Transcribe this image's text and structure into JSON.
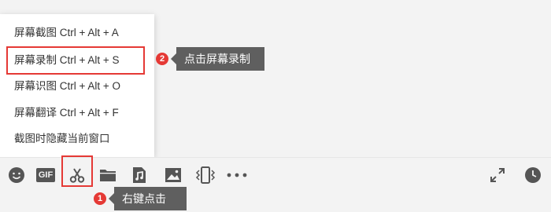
{
  "context_menu": {
    "items": [
      {
        "label": "屏幕截图 Ctrl + Alt + A"
      },
      {
        "label": "屏幕录制 Ctrl + Alt + S"
      },
      {
        "label": "屏幕识图 Ctrl + Alt + O"
      },
      {
        "label": "屏幕翻译 Ctrl + Alt + F"
      },
      {
        "label": "截图时隐藏当前窗口"
      }
    ]
  },
  "toolbar": {
    "icons": [
      "emoji-icon",
      "gif-icon",
      "scissors-icon",
      "folder-icon",
      "music-file-icon",
      "image-icon",
      "shake-icon",
      "more-icon",
      "expand-icon",
      "history-clock-icon"
    ],
    "gif_text": "GIF"
  },
  "annotations": {
    "step1": {
      "number": "1",
      "text": "右键点击"
    },
    "step2": {
      "number": "2",
      "text": "点击屏幕录制"
    }
  },
  "colors": {
    "highlight": "#e53935",
    "callout_bg": "#5f5f5f",
    "icon": "#555555"
  }
}
